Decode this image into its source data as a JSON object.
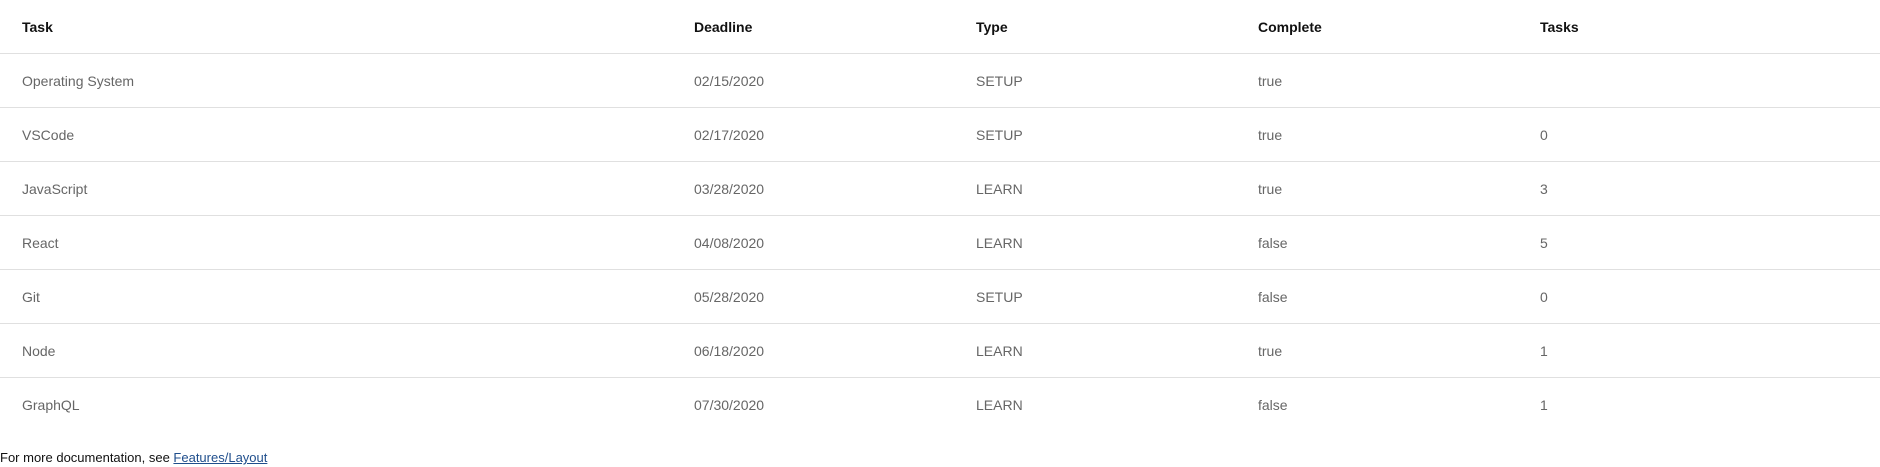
{
  "table": {
    "headers": [
      "Task",
      "Deadline",
      "Type",
      "Complete",
      "Tasks"
    ],
    "rows": [
      {
        "task": "Operating System",
        "deadline": "02/15/2020",
        "type": "SETUP",
        "complete": "true",
        "tasks": ""
      },
      {
        "task": "VSCode",
        "deadline": "02/17/2020",
        "type": "SETUP",
        "complete": "true",
        "tasks": "0"
      },
      {
        "task": "JavaScript",
        "deadline": "03/28/2020",
        "type": "LEARN",
        "complete": "true",
        "tasks": "3"
      },
      {
        "task": "React",
        "deadline": "04/08/2020",
        "type": "LEARN",
        "complete": "false",
        "tasks": "5"
      },
      {
        "task": "Git",
        "deadline": "05/28/2020",
        "type": "SETUP",
        "complete": "false",
        "tasks": "0"
      },
      {
        "task": "Node",
        "deadline": "06/18/2020",
        "type": "LEARN",
        "complete": "true",
        "tasks": "1"
      },
      {
        "task": "GraphQL",
        "deadline": "07/30/2020",
        "type": "LEARN",
        "complete": "false",
        "tasks": "1"
      }
    ]
  },
  "footer": {
    "text": "For more documentation, see ",
    "link_label": "Features/Layout"
  }
}
